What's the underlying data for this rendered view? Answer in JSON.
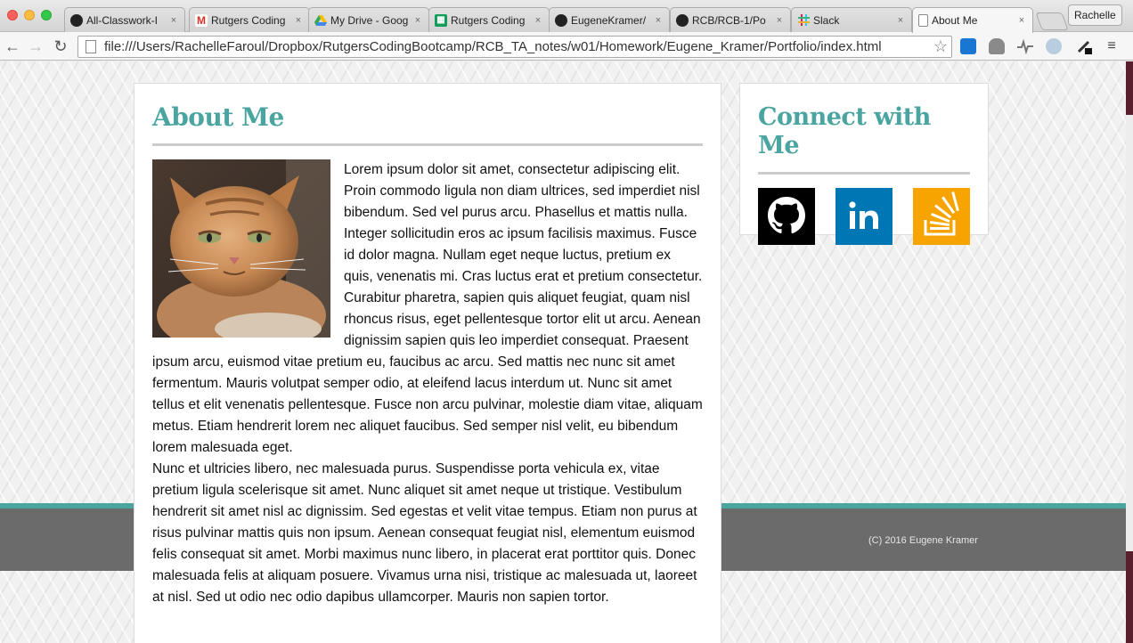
{
  "browser": {
    "tabs": [
      {
        "title": "All-Classwork-I",
        "favicon": "github-icon"
      },
      {
        "title": "Rutgers Coding",
        "favicon": "gmail-icon"
      },
      {
        "title": "My Drive - Goog",
        "favicon": "drive-icon"
      },
      {
        "title": "Rutgers Coding",
        "favicon": "sheets-icon"
      },
      {
        "title": "EugeneKramer/",
        "favicon": "github-icon"
      },
      {
        "title": "RCB/RCB-1/Po",
        "favicon": "github-icon"
      },
      {
        "title": "Slack",
        "favicon": "slack-icon"
      },
      {
        "title": "About Me",
        "favicon": "page-icon",
        "active": true
      }
    ],
    "close_glyph": "×",
    "profile_name": "Rachelle",
    "url": "file:///Users/RachelleFaroul/Dropbox/RutgersCodingBootcamp/RCB_TA_notes/w01/Homework/Eugene_Kramer/Portfolio/index.html"
  },
  "page": {
    "about": {
      "heading": "About Me",
      "paragraph1": "Lorem ipsum dolor sit amet, consectetur adipiscing elit. Proin commodo ligula non diam ultrices, sed imperdiet nisl bibendum. Sed vel purus arcu. Phasellus et mattis nulla. Integer sollicitudin eros ac ipsum facilisis maximus. Fusce id dolor magna. Nullam eget neque luctus, pretium ex quis, venenatis mi. Cras luctus erat et pretium consectetur. Curabitur pharetra, sapien quis aliquet feugiat, quam nisl rhoncus risus, eget pellentesque tortor elit ut arcu. Aenean dignissim sapien quis leo imperdiet consequat. Praesent ipsum arcu, euismod vitae pretium eu, faucibus ac arcu. Sed mattis nec nunc sit amet fermentum. Mauris volutpat semper odio, at eleifend lacus interdum ut. Nunc sit amet tellus et elit venenatis pellentesque. Fusce non arcu pulvinar, molestie diam vitae, aliquam metus. Etiam hendrerit lorem nec aliquet faucibus. Sed semper nisl velit, eu bibendum lorem malesuada eget.",
      "paragraph2": "Nunc et ultricies libero, nec malesuada purus. Suspendisse porta vehicula ex, vitae pretium ligula scelerisque sit amet. Nunc aliquet sit amet neque ut tristique. Vestibulum hendrerit sit amet nisl ac dignissim. Sed egestas et velit vitae tempus. Etiam non purus at risus pulvinar mattis quis non ipsum. Aenean consequat feugiat nisl, elementum euismod felis consequat sit amet. Morbi maximus nunc libero, in placerat erat porttitor quis. Donec malesuada felis at aliquam posuere. Vivamus urna nisi, tristique ac malesuada ut, laoreet at nisl. Sed ut odio nec odio dapibus ullamcorper. Mauris non sapien tortor."
    },
    "connect": {
      "heading": "Connect with Me",
      "links": [
        {
          "icon": "github-icon",
          "color": "#000000"
        },
        {
          "icon": "linkedin-icon",
          "color": "#0077b5"
        },
        {
          "icon": "stackoverflow-icon",
          "color": "#f7a400"
        }
      ]
    },
    "footer": {
      "copyright": "(C) 2016 Eugene Kramer"
    },
    "colors": {
      "accent": "#4aa5a0",
      "footer": "#6b6b6b"
    }
  }
}
